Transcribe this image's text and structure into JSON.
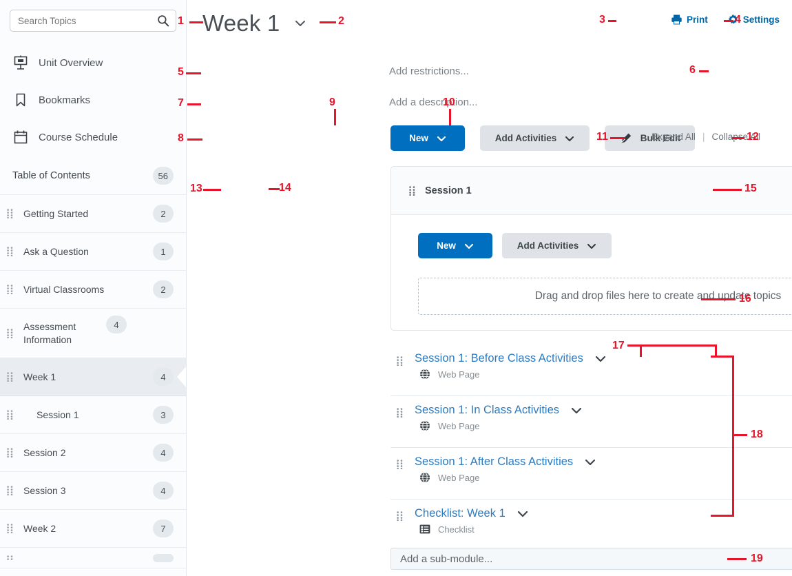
{
  "sidebar": {
    "search": {
      "placeholder": "Search Topics",
      "value": "",
      "icon": "search-icon"
    },
    "nav_items": [
      {
        "label": "Unit Overview",
        "icon": "presentation-icon"
      },
      {
        "label": "Bookmarks",
        "icon": "bookmark-icon"
      },
      {
        "label": "Course Schedule",
        "icon": "calendar-icon"
      }
    ],
    "toc": {
      "title": "Table of Contents",
      "count": "56"
    },
    "toc_items": [
      {
        "label": "Getting Started",
        "count": "2",
        "indent": false,
        "selected": false
      },
      {
        "label": "Ask a Question",
        "count": "1",
        "indent": false,
        "selected": false
      },
      {
        "label": "Virtual Classrooms",
        "count": "2",
        "indent": false,
        "selected": false
      },
      {
        "label": "Assessment Information",
        "count": "4",
        "indent": false,
        "selected": false
      },
      {
        "label": "Week 1",
        "count": "4",
        "indent": false,
        "selected": true
      },
      {
        "label": "Session 1",
        "count": "3",
        "indent": true,
        "selected": false
      },
      {
        "label": "Session 2",
        "count": "4",
        "indent": false,
        "selected": false
      },
      {
        "label": "Session 3",
        "count": "4",
        "indent": false,
        "selected": false
      },
      {
        "label": "Week 2",
        "count": "7",
        "indent": false,
        "selected": false
      }
    ]
  },
  "header": {
    "title": "Week 1",
    "title_caret_icon": "chevron-down-icon",
    "print_label": "Print",
    "print_icon": "printer-icon",
    "settings_label": "Settings",
    "settings_icon": "gear-icon",
    "link_color": "#0066a6"
  },
  "module": {
    "restrictions_placeholder": "Add restrictions...",
    "description_placeholder": "Add a description...",
    "visibility_icon": "eye-icon",
    "new_label": "New",
    "add_activities_label": "Add Activities",
    "bulk_edit_label": "Bulk Edit",
    "bulk_edit_icon": "pencil-icon",
    "expand_all_label": "Expand All",
    "collapse_all_label": "Collapse All",
    "separator": "|",
    "primary_color": "#006fbf",
    "secondary_color": "#dfe3e8"
  },
  "submodule_card": {
    "name": "Session 1",
    "grip_icon": "drag-handle-icon",
    "collapse_icon": "triangle-down-icon",
    "new_label": "New",
    "add_activities_label": "Add Activities",
    "dropzone_text": "Drag and drop files here to create and update topics"
  },
  "topics": [
    {
      "title": "Session 1: Before Class Activities",
      "type": "Web Page",
      "type_icon": "globe-icon",
      "caret_icon": "chevron-down-icon",
      "actions": [
        "reading-level-icon",
        "readspeaker-icon",
        "completion-check-icon"
      ]
    },
    {
      "title": "Session 1: In Class Activities",
      "type": "Web Page",
      "type_icon": "globe-icon",
      "caret_icon": "chevron-down-icon",
      "actions": [
        "reading-level-icon",
        "readspeaker-icon",
        "completion-check-icon"
      ]
    },
    {
      "title": "Session 1: After Class Activities",
      "type": "Web Page",
      "type_icon": "globe-icon",
      "caret_icon": "chevron-down-icon",
      "actions": [
        "reading-level-icon",
        "readspeaker-icon",
        "completion-check-icon"
      ]
    },
    {
      "title": "Checklist: Week 1",
      "type": "Checklist",
      "type_icon": "checklist-icon",
      "caret_icon": "chevron-down-icon",
      "actions": [
        "completion-check-icon"
      ]
    }
  ],
  "add_submodule": {
    "placeholder": "Add a sub-module...",
    "value": ""
  },
  "annotations": {
    "color": "#e8152a",
    "labels": [
      "1",
      "2",
      "3",
      "4",
      "5",
      "6",
      "7",
      "8",
      "9",
      "10",
      "11",
      "12",
      "13",
      "14",
      "15",
      "16",
      "17",
      "18",
      "19"
    ]
  }
}
